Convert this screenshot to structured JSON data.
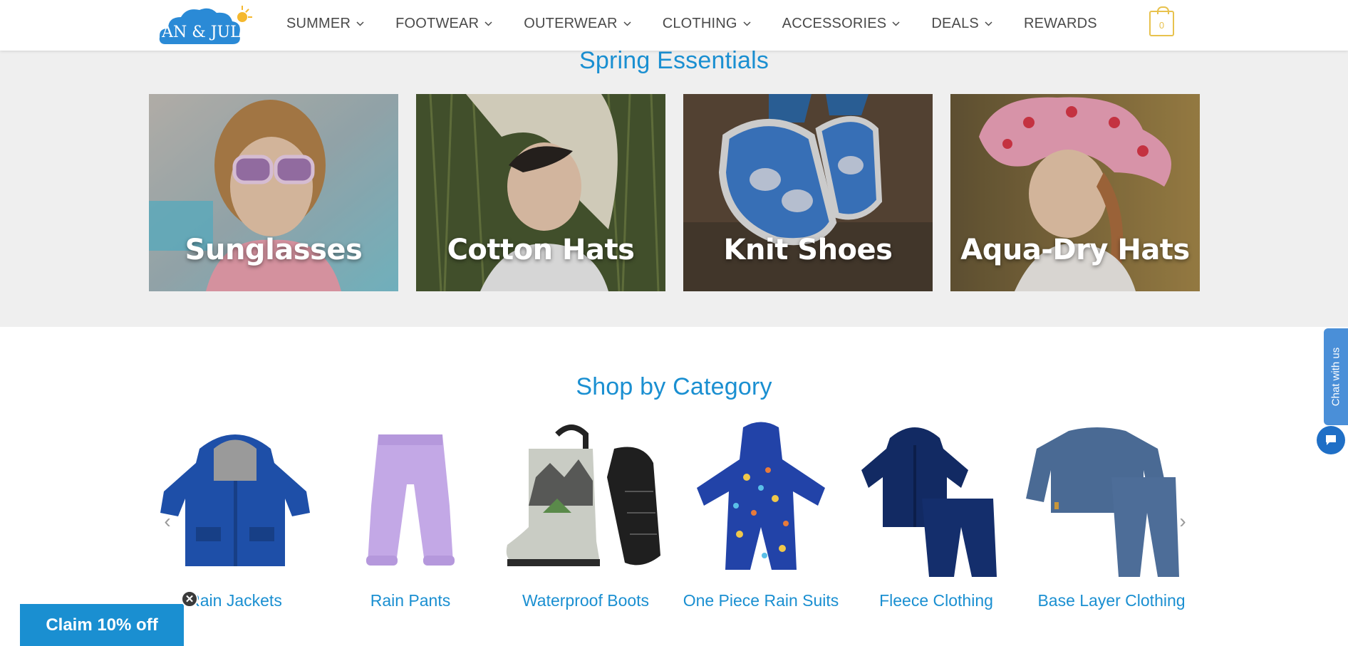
{
  "brand": {
    "logo_text": "JAN & JUL"
  },
  "nav": {
    "items": [
      {
        "label": "SUMMER",
        "has_dropdown": true
      },
      {
        "label": "FOOTWEAR",
        "has_dropdown": true
      },
      {
        "label": "OUTERWEAR",
        "has_dropdown": true
      },
      {
        "label": "CLOTHING",
        "has_dropdown": true
      },
      {
        "label": "ACCESSORIES",
        "has_dropdown": true
      },
      {
        "label": "DEALS",
        "has_dropdown": true
      },
      {
        "label": "REWARDS",
        "has_dropdown": false
      }
    ],
    "cart_count": "0"
  },
  "spring": {
    "title": "Spring Essentials",
    "tiles": [
      {
        "label": "Sunglasses"
      },
      {
        "label": "Cotton Hats"
      },
      {
        "label": "Knit Shoes"
      },
      {
        "label": "Aqua-Dry Hats"
      }
    ]
  },
  "categories": {
    "title": "Shop by Category",
    "items": [
      {
        "label": "Rain Jackets"
      },
      {
        "label": "Rain Pants"
      },
      {
        "label": "Waterproof Boots"
      },
      {
        "label": "One Piece Rain Suits"
      },
      {
        "label": "Fleece Clothing"
      },
      {
        "label": "Base Layer Clothing"
      }
    ],
    "prev_icon": "chevron-left-icon",
    "next_icon": "chevron-right-icon"
  },
  "chat": {
    "label": "Chat with us"
  },
  "promo": {
    "label": "Claim 10% off",
    "close_glyph": "✕"
  },
  "colors": {
    "accent": "#1a8fd1",
    "cart": "#e8c24e",
    "chat": "#4a8fd8",
    "band": "#efefef"
  }
}
